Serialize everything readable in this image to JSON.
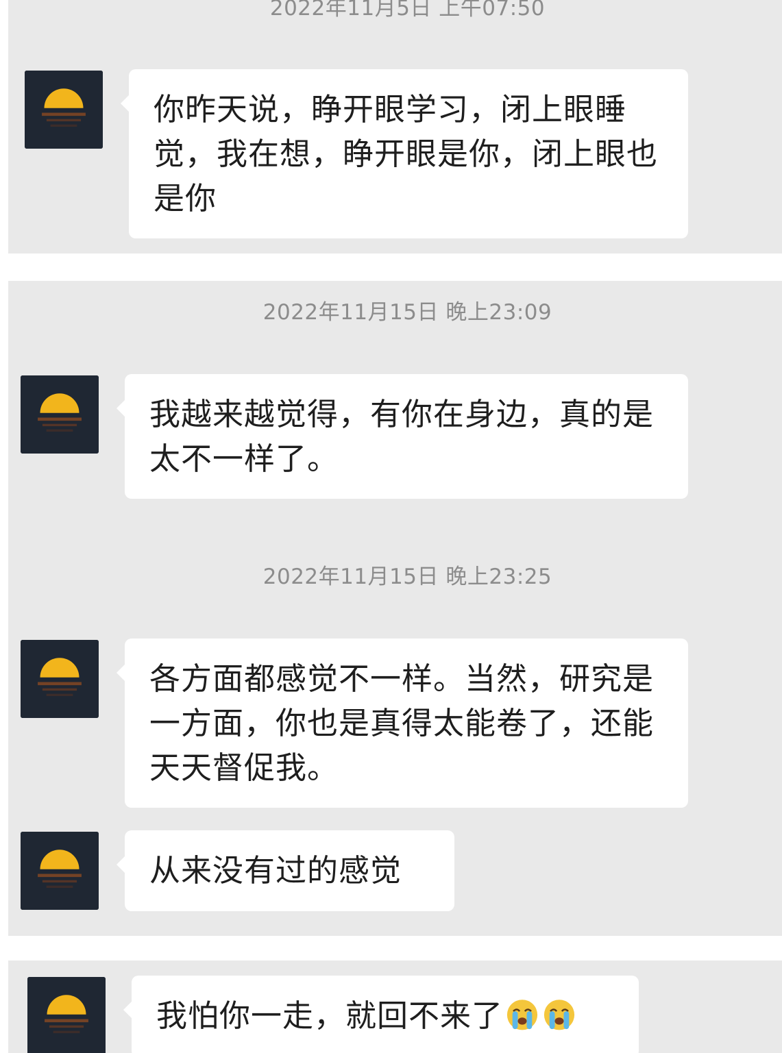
{
  "messages": [
    {
      "timestamp": "2022年11月5日 上午07:50",
      "text": "你昨天说，睁开眼学习，闭上眼睡觉，我在想，睁开眼是你，闭上眼也是你"
    },
    {
      "timestamp": "2022年11月15日 晚上23:09",
      "text": "我越来越觉得，有你在身边，真的是太不一样了。"
    },
    {
      "timestamp": "2022年11月15日 晚上23:25",
      "text": "各方面都感觉不一样。当然，研究是一方面，你也是真得太能卷了，还能天天督促我。"
    },
    {
      "text": "从来没有过的感觉"
    },
    {
      "text": "我怕你一走，就回不来了",
      "emoji": [
        "crying-face-icon",
        "crying-face-icon"
      ]
    }
  ],
  "colors": {
    "chat_background": "#e9e9e9",
    "bubble": "#ffffff",
    "timestamp_text": "#8c8c8c",
    "avatar_sun": "#f2b51c"
  }
}
